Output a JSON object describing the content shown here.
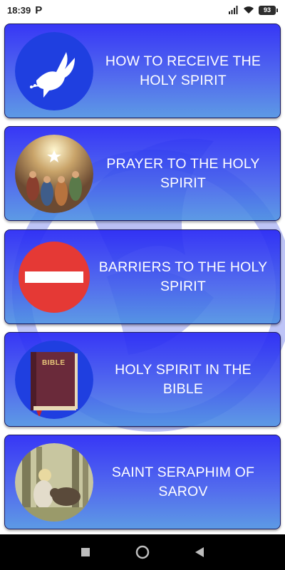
{
  "status_bar": {
    "time": "18:39",
    "notification_icon": "parking-p-icon",
    "battery": "93",
    "icons": [
      "signal-icon",
      "wifi-icon",
      "battery-icon"
    ]
  },
  "cards": [
    {
      "label": "HOW TO RECEIVE THE HOLY SPIRIT",
      "image": "dove-icon"
    },
    {
      "label": "PRAYER TO THE HOLY SPIRIT",
      "image": "pentecost-painting"
    },
    {
      "label": "BARRIERS TO THE HOLY SPIRIT",
      "image": "no-entry-icon"
    },
    {
      "label": "HOLY SPIRIT IN THE BIBLE",
      "image": "bible-book-icon",
      "book_text": "BIBLE"
    },
    {
      "label": "SAINT SERAPHIM OF SAROV",
      "image": "saint-seraphim-painting"
    }
  ],
  "nav_bar": {
    "buttons": [
      "recents-square-icon",
      "home-circle-icon",
      "back-triangle-icon"
    ]
  },
  "colors": {
    "card_top": "#2828F5",
    "card_bottom": "#468CE1",
    "label_text": "#FFFFFF",
    "thumb_blue": "#1F3FE0",
    "no_entry_red": "#E53935"
  }
}
